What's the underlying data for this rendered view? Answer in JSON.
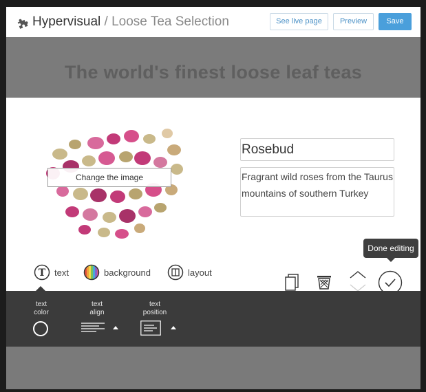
{
  "header": {
    "brand": "Hypervisual",
    "separator": "/",
    "page_name": "Loose Tea Selection",
    "buttons": {
      "live": "See live page",
      "preview": "Preview",
      "save": "Save"
    }
  },
  "hero": {
    "title": "The world's finest loose leaf teas"
  },
  "product": {
    "change_image_label": "Change the image",
    "name": "Rosebud",
    "description": "Fragrant wild roses from the Taurus mountains of southern Turkey"
  },
  "toolbar": {
    "text_label": "text",
    "background_label": "background",
    "layout_label": "layout",
    "text_icon_glyph": "T",
    "icons": [
      "duplicate-icon",
      "trash-icon",
      "move-up-icon",
      "move-down-icon",
      "checkmark-icon"
    ],
    "done_tooltip": "Done editing"
  },
  "settings_panel": {
    "text_color_label": "text\ncolor",
    "text_align_label": "text\nalign",
    "text_position_label": "text\nposition"
  },
  "colors": {
    "accent": "#4a9fdb",
    "panel": "#3b3b3b",
    "hero_bg": "#7b7b7b"
  }
}
